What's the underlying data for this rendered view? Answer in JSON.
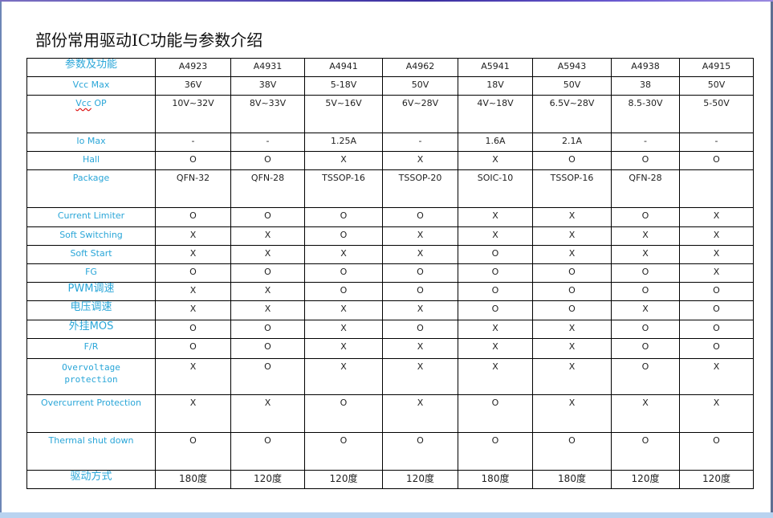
{
  "document": {
    "title": "部份常用驱动IC功能与参数介绍"
  },
  "table": {
    "corner_label": "参数及功能",
    "columns": [
      "A4923",
      "A4931",
      "A4941",
      "A4962",
      "A5941",
      "A5943",
      "A4938",
      "A4915"
    ],
    "rows": [
      {
        "label": "Vcc Max",
        "values": [
          "36V",
          "38V",
          "5-18V",
          "50V",
          "18V",
          "50V",
          "38",
          "50V"
        ]
      },
      {
        "label": "Vcc OP",
        "values": [
          "10V~32V",
          "8V~33V",
          "5V~16V",
          "6V~28V",
          "4V~18V",
          "6.5V~28V",
          "8.5-30V",
          "5-50V"
        ]
      },
      {
        "label": "Io Max",
        "values": [
          "-",
          "-",
          "1.25A",
          "-",
          "1.6A",
          "2.1A",
          "-",
          "-"
        ]
      },
      {
        "label": "Hall",
        "values": [
          "O",
          "O",
          "X",
          "X",
          "X",
          "O",
          "O",
          "O"
        ]
      },
      {
        "label": "Package",
        "values": [
          "QFN-32",
          "QFN-28",
          "TSSOP-16",
          "TSSOP-20",
          "SOIC-10",
          "TSSOP-16",
          "QFN-28",
          ""
        ]
      },
      {
        "label": "Current Limiter",
        "values": [
          "O",
          "O",
          "O",
          "O",
          "X",
          "X",
          "O",
          "X"
        ]
      },
      {
        "label": "Soft Switching",
        "values": [
          "X",
          "X",
          "O",
          "X",
          "X",
          "X",
          "X",
          "X"
        ]
      },
      {
        "label": "Soft Start",
        "values": [
          "X",
          "X",
          "X",
          "X",
          "O",
          "X",
          "X",
          "X"
        ]
      },
      {
        "label": "FG",
        "values": [
          "O",
          "O",
          "O",
          "O",
          "O",
          "O",
          "O",
          "X"
        ]
      },
      {
        "label": "PWM调速",
        "values": [
          "X",
          "X",
          "O",
          "O",
          "O",
          "O",
          "O",
          "O"
        ]
      },
      {
        "label": "电压调速",
        "values": [
          "X",
          "X",
          "X",
          "X",
          "O",
          "O",
          "X",
          "O"
        ]
      },
      {
        "label": "外挂MOS",
        "values": [
          "O",
          "O",
          "X",
          "O",
          "X",
          "X",
          "O",
          "O"
        ]
      },
      {
        "label": "F/R",
        "values": [
          "O",
          "O",
          "X",
          "X",
          "X",
          "X",
          "O",
          "O"
        ]
      },
      {
        "label_line1": "Overvoltage",
        "label_line2": "protection",
        "values": [
          "X",
          "O",
          "X",
          "X",
          "X",
          "X",
          "O",
          "X"
        ]
      },
      {
        "label": "Overcurrent Protection",
        "values": [
          "X",
          "X",
          "O",
          "X",
          "O",
          "X",
          "X",
          "X"
        ]
      },
      {
        "label": "Thermal shut down",
        "values": [
          "O",
          "O",
          "O",
          "O",
          "O",
          "O",
          "O",
          "O"
        ]
      },
      {
        "label": "驱动方式",
        "values": [
          "180度",
          "120度",
          "120度",
          "120度",
          "180度",
          "180度",
          "120度",
          "120度"
        ]
      }
    ]
  },
  "colors": {
    "label_text": "#2aa6d8",
    "cell_text": "#222222",
    "border": "#000000"
  }
}
